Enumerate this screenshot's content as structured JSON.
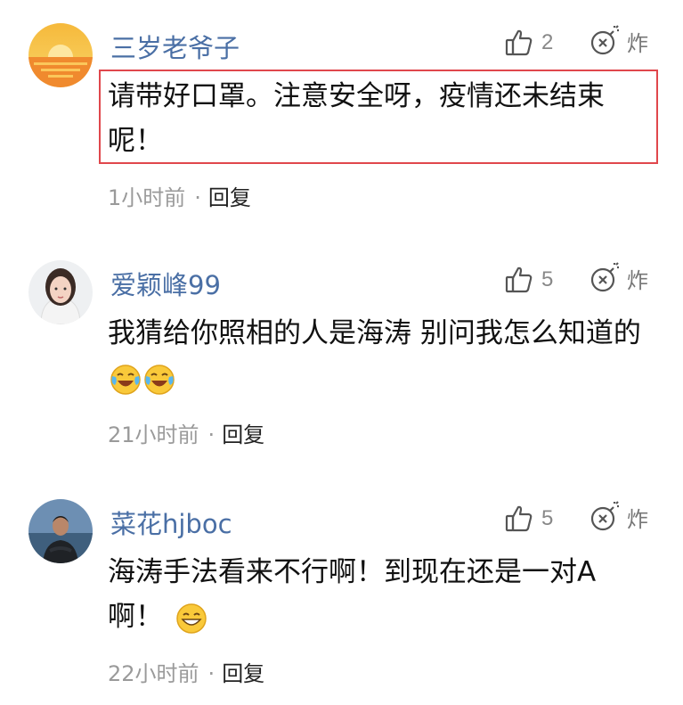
{
  "comments": [
    {
      "username": "三岁老爷子",
      "likes": "2",
      "bomb_label": "炸",
      "text": "请带好口罩。注意安全呀，疫情还未结束呢！",
      "time": "1小时前",
      "separator": "·",
      "reply": "回复",
      "avatar": "sunset-avatar",
      "highlighted": true
    },
    {
      "username": "爱颖峰99",
      "likes": "5",
      "bomb_label": "炸",
      "text": "我猜给你照相的人是海涛  别问我怎么知道的",
      "emojis": [
        "laughing-crying-emoji",
        "laughing-crying-emoji"
      ],
      "time": "21小时前",
      "separator": "·",
      "reply": "回复",
      "avatar": "woman-portrait-avatar"
    },
    {
      "username": "菜花hjboc",
      "likes": "5",
      "bomb_label": "炸",
      "text": "海涛手法看来不行啊！到现在还是一对A啊！",
      "emojis": [
        "grinning-emoji"
      ],
      "time": "22小时前",
      "separator": "·",
      "reply": "回复",
      "avatar": "man-beach-avatar"
    }
  ],
  "colors": {
    "username": "#4a6fa5",
    "highlight_border": "#e0474c",
    "meta": "#9a9a9a"
  }
}
